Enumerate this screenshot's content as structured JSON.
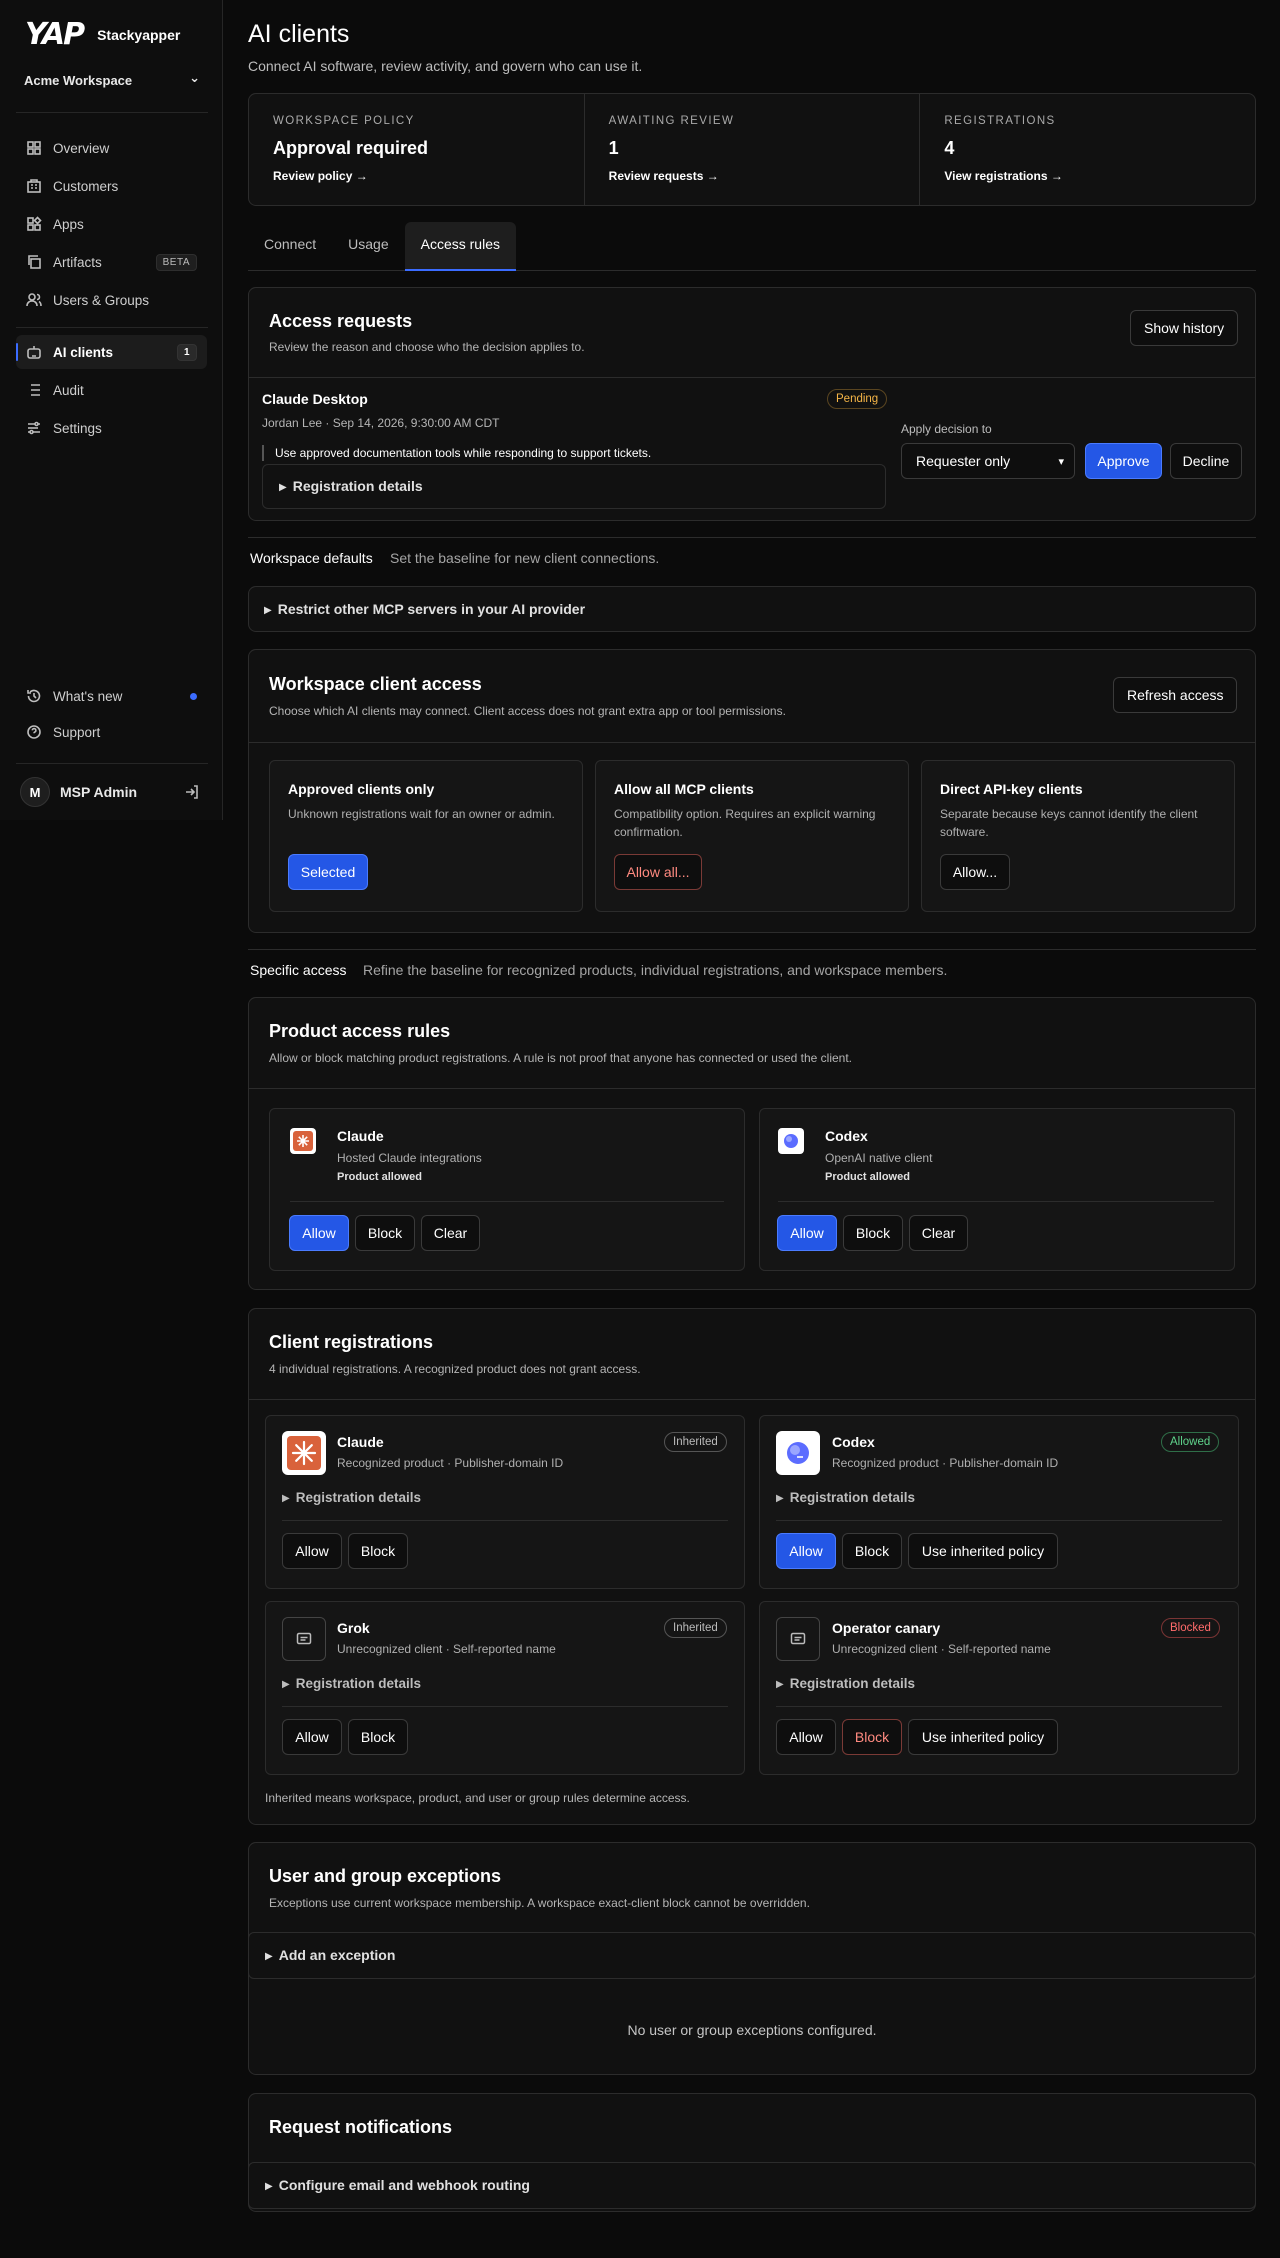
{
  "brand": {
    "logo": "YAP",
    "name": "Stackyapper"
  },
  "workspace": {
    "name": "Acme Workspace",
    "chevron": "⌄"
  },
  "nav": [
    {
      "label": "Overview",
      "icon": "grid-icon"
    },
    {
      "label": "Customers",
      "icon": "building-icon"
    },
    {
      "label": "Apps",
      "icon": "apps-icon"
    },
    {
      "label": "Artifacts",
      "icon": "copy-icon",
      "badge": "BETA"
    },
    {
      "label": "Users & Groups",
      "icon": "users-icon"
    },
    {
      "label": "AI clients",
      "icon": "robot-icon",
      "badge": "1",
      "active": true
    },
    {
      "label": "Audit",
      "icon": "list-icon"
    },
    {
      "label": "Settings",
      "icon": "sliders-icon"
    }
  ],
  "footer_nav": [
    {
      "label": "What's new",
      "icon": "history-icon"
    },
    {
      "label": "Support",
      "icon": "help-icon"
    }
  ],
  "user": {
    "initial": "M",
    "name": "MSP Admin"
  },
  "page": {
    "title": "AI clients",
    "subtitle": "Connect AI software, review activity, and govern who can use it."
  },
  "stats": [
    {
      "label": "Workspace policy",
      "value": "Approval required",
      "link": "Review policy →"
    },
    {
      "label": "Awaiting review",
      "value": "1",
      "link": "Review requests →"
    },
    {
      "label": "Registrations",
      "value": "4",
      "link": "View registrations →"
    }
  ],
  "tabs": [
    "Connect",
    "Usage",
    "Access rules"
  ],
  "access_requests": {
    "title": "Access requests",
    "desc": "Review the reason and choose who the decision applies to.",
    "history_button": "Show history",
    "request": {
      "client": "Claude Desktop",
      "status": "Pending",
      "meta": "Jordan Lee · Sep 14, 2026, 9:30:00 AM CDT",
      "reason": "Use approved documentation tools while responding to support tickets.",
      "details": "Registration details",
      "apply_label": "Apply decision to",
      "apply_value": "Requester only",
      "approve": "Approve",
      "decline": "Decline"
    }
  },
  "workspace_defaults": {
    "label": "Workspace defaults",
    "desc": "Set the baseline for new client connections."
  },
  "restrict": "Restrict other MCP servers in your AI provider",
  "client_access": {
    "title": "Workspace client access",
    "desc": "Choose which AI clients may connect. Client access does not grant extra app or tool permissions.",
    "refresh": "Refresh access",
    "options": [
      {
        "title": "Approved clients only",
        "desc": "Unknown registrations wait for an owner or admin.",
        "button": "Selected"
      },
      {
        "title": "Allow all MCP clients",
        "desc": "Compatibility option. Requires an explicit warning confirmation.",
        "button": "Allow all..."
      },
      {
        "title": "Direct API-key clients",
        "desc": "Separate because keys cannot identify the client software.",
        "button": "Allow..."
      }
    ]
  },
  "specific_access": {
    "label": "Specific access",
    "desc": "Refine the baseline for recognized products, individual registrations, and workspace members."
  },
  "product_rules": {
    "title": "Product access rules",
    "desc": "Allow or block matching product registrations. A rule is not proof that anyone has connected or used the client.",
    "products": [
      {
        "name": "Claude",
        "desc": "Hosted Claude integrations",
        "status": "Product allowed"
      },
      {
        "name": "Codex",
        "desc": "OpenAI native client",
        "status": "Product allowed"
      }
    ],
    "allow": "Allow",
    "block": "Block",
    "clear": "Clear"
  },
  "registrations": {
    "title": "Client registrations",
    "desc": "4 individual registrations. A recognized product does not grant access.",
    "items": [
      {
        "name": "Claude",
        "meta": "Recognized product · Publisher-domain ID",
        "status": "Inherited"
      },
      {
        "name": "Codex",
        "meta": "Recognized product · Publisher-domain ID",
        "status": "Allowed"
      },
      {
        "name": "Grok",
        "meta": "Unrecognized client · Self-reported name",
        "status": "Inherited"
      },
      {
        "name": "Operator canary",
        "meta": "Unrecognized client · Self-reported name",
        "status": "Blocked"
      }
    ],
    "details": "Registration details",
    "allow": "Allow",
    "block": "Block",
    "inherit": "Use inherited policy",
    "footnote": "Inherited means workspace, product, and user or group rules determine access."
  },
  "exceptions": {
    "title": "User and group exceptions",
    "desc": "Exceptions use current workspace membership. A workspace exact-client block cannot be overridden.",
    "add": "Add an exception",
    "empty": "No user or group exceptions configured."
  },
  "notifications": {
    "title": "Request notifications",
    "configure": "Configure email and webhook routing"
  },
  "colors": {
    "accent": "#2457e6",
    "pending": "#f5b547",
    "allowed": "#5fd38b",
    "blocked": "#ff6b6b",
    "claude": "#d9623b",
    "codex": "#5b6cff"
  }
}
